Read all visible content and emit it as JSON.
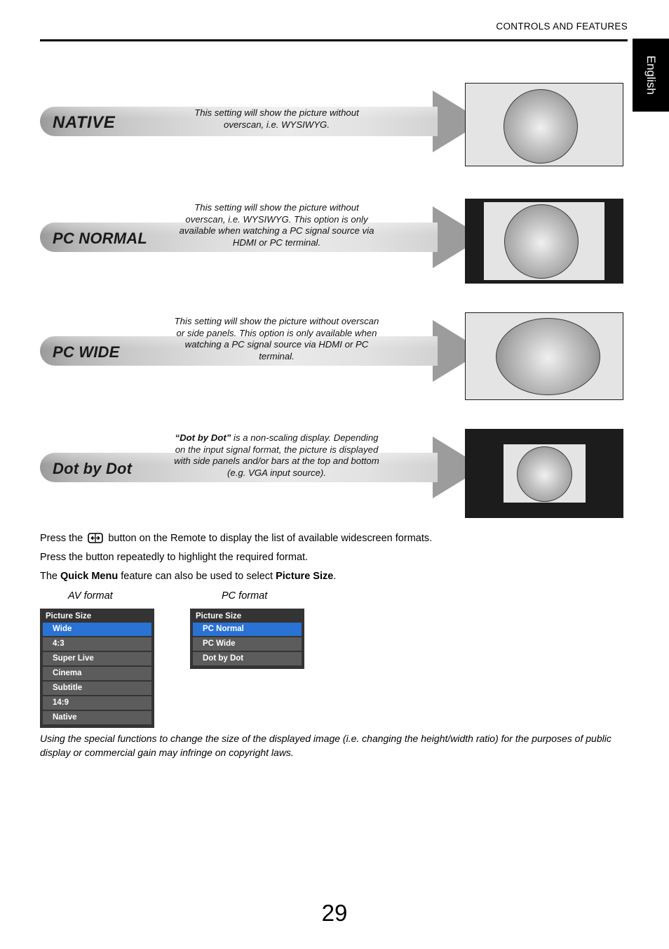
{
  "header": {
    "title": "CONTROLS AND FEATURES",
    "language_tab": "English"
  },
  "format_rows": [
    {
      "name": "NATIVE",
      "label": "NATIVE",
      "description": "This setting will show the picture without overscan, i.e. WYSIWYG.",
      "illustration": "full-screen-circle"
    },
    {
      "name": "PC NORMAL",
      "label": "PC NORMAL",
      "description": "This setting will show the picture without overscan, i.e. WYSIWYG. This option is only available when watching a PC signal source via HDMI or PC terminal.",
      "illustration": "side-panels-circle"
    },
    {
      "name": "PC WIDE",
      "label": "PC WIDE",
      "description": "This setting will show the picture without overscan or side panels. This option is only available when watching a PC signal source via HDMI or PC terminal.",
      "illustration": "full-screen-ellipse"
    },
    {
      "name": "Dot by Dot",
      "label": "Dot by Dot",
      "description_bold": "“Dot by Dot”",
      "description": " is a non-scaling display. Depending on the input signal format, the picture is displayed with side panels and/or bars at the top and bottom (e.g. VGA input source).",
      "illustration": "small-window-circle"
    }
  ],
  "instructions": {
    "line1_before": "Press the",
    "line1_icon": "widescreen-format-button-icon",
    "line1_after": "button on the Remote to display the list of available widescreen formats.",
    "line2": "Press the button repeatedly to highlight the required format.",
    "line3_before": "The ",
    "line3_bold1": "Quick Menu",
    "line3_middle": " feature can also be used to select ",
    "line3_bold2": "Picture Size",
    "line3_after": "."
  },
  "menus": [
    {
      "caption": "AV format",
      "heading": "Picture Size",
      "items": [
        {
          "label": "Wide",
          "selected": true
        },
        {
          "label": "4:3",
          "selected": false
        },
        {
          "label": "Super Live",
          "selected": false
        },
        {
          "label": "Cinema",
          "selected": false
        },
        {
          "label": "Subtitle",
          "selected": false
        },
        {
          "label": "14:9",
          "selected": false
        },
        {
          "label": "Native",
          "selected": false
        }
      ]
    },
    {
      "caption": "PC format",
      "heading": "Picture Size",
      "items": [
        {
          "label": "PC Normal",
          "selected": true
        },
        {
          "label": "PC Wide",
          "selected": false
        },
        {
          "label": "Dot by Dot",
          "selected": false
        }
      ]
    }
  ],
  "footnote": "Using the special functions to change the size of the displayed image (i.e. changing the height/width ratio) for the purposes of public display or commercial gain may infringe on copyright laws.",
  "page_number": "29",
  "colors": {
    "menu_background": "#343434",
    "menu_item": "#5c5c5c",
    "menu_selected": "#2a72d4",
    "banner_arrow": "#9c9c9c",
    "tv_screen": "#e4e4e4",
    "tv_matte": "#1c1c1c",
    "language_tab": "#000000"
  }
}
